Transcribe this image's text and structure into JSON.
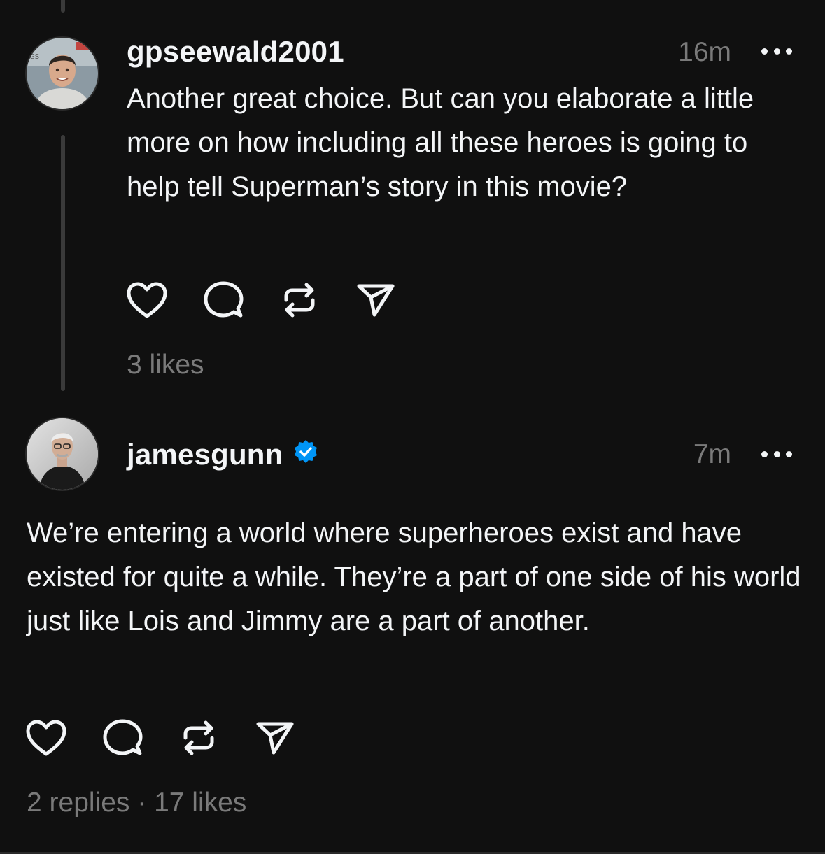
{
  "posts": [
    {
      "username": "gpseewald2001",
      "time": "16m",
      "text": "Another great choice. But can you elaborate a little more on how including all these heroes is going to help tell Superman’s story in this movie?",
      "stats": "3 likes",
      "verified": false,
      "avatar_icon": "user-photo"
    },
    {
      "username": "jamesgunn",
      "time": "7m",
      "text": "We’re entering a world where superheroes exist and have existed for quite a while. They’re a part of one side of his world just like Lois and Jimmy are a part of another.",
      "stats": "2 replies · 17 likes",
      "verified": true,
      "avatar_icon": "user-photo"
    }
  ],
  "icons": {
    "like": "heart-icon",
    "reply": "comment-bubble-icon",
    "repost": "repost-icon",
    "share": "send-icon",
    "more": "more-dots-icon",
    "verified": "verified-badge-icon"
  },
  "colors": {
    "background": "#101010",
    "text": "#f3f5f7",
    "secondary_text": "#7a7a7a",
    "thread_line": "#3a3a3a",
    "verified": "#0095f6"
  }
}
